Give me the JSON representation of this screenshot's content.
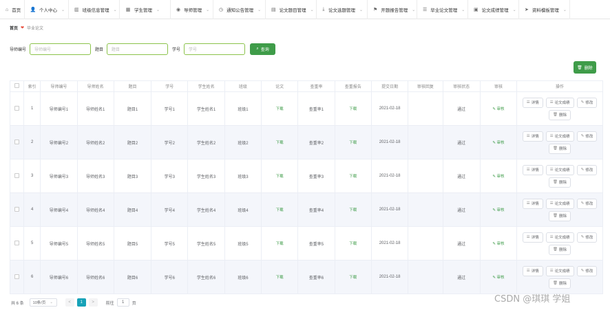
{
  "nav": [
    {
      "label": "首页",
      "icon": "home-icon",
      "glyph": "⌂",
      "chevron": false
    },
    {
      "label": "个人中心",
      "icon": "user-icon",
      "glyph": "👤",
      "chevron": true
    },
    {
      "label": "班级信息管理",
      "icon": "chart-icon",
      "glyph": "▥",
      "chevron": true
    },
    {
      "label": "学生管理",
      "icon": "grid-icon",
      "glyph": "▦",
      "chevron": true
    },
    {
      "label": "导师管理",
      "icon": "eye-icon",
      "glyph": "◉",
      "chevron": true
    },
    {
      "label": "通知公告管理",
      "icon": "clock-icon",
      "glyph": "◷",
      "chevron": true
    },
    {
      "label": "论文题目管理",
      "icon": "doc-icon",
      "glyph": "▤",
      "chevron": true
    },
    {
      "label": "论文选题管理",
      "icon": "download-icon",
      "glyph": "⤓",
      "chevron": true
    },
    {
      "label": "开题报告管理",
      "icon": "flag-icon",
      "glyph": "⚑",
      "chevron": true
    },
    {
      "label": "毕业论文管理",
      "icon": "list-icon",
      "glyph": "☰",
      "chevron": true
    },
    {
      "label": "论文成绩管理",
      "icon": "image-icon",
      "glyph": "▣",
      "chevron": true
    },
    {
      "label": "资料模板管理",
      "icon": "send-icon",
      "glyph": "➤",
      "chevron": true
    }
  ],
  "breadcrumb": {
    "home": "首页",
    "current": "毕业论文"
  },
  "search": {
    "tutor_no_label": "导师编号",
    "tutor_no_placeholder": "导师编号",
    "title_label": "题目",
    "title_placeholder": "题目",
    "student_no_label": "学号",
    "student_no_placeholder": "学号",
    "button": "查询"
  },
  "toolbar": {
    "delete_label": "删除"
  },
  "table": {
    "headers": [
      "",
      "索引",
      "导师编号",
      "导师姓名",
      "题目",
      "学号",
      "学生姓名",
      "班级",
      "论文",
      "查重率",
      "查重报告",
      "提交日期",
      "审核回复",
      "审核状态",
      "审核",
      "操作"
    ],
    "rows": [
      {
        "index": "1",
        "tutor_no": "导师编号1",
        "tutor_name": "导师姓名1",
        "title": "题目1",
        "student_no": "学号1",
        "student_name": "学生姓名1",
        "class": "班级1",
        "paper": "下载",
        "dup_rate": "查重率1",
        "report": "下载",
        "date": "2021-02-18",
        "reply": "",
        "status": "通过",
        "review": "审核"
      },
      {
        "index": "2",
        "tutor_no": "导师编号2",
        "tutor_name": "导师姓名2",
        "title": "题目2",
        "student_no": "学号2",
        "student_name": "学生姓名2",
        "class": "班级2",
        "paper": "下载",
        "dup_rate": "查重率2",
        "report": "下载",
        "date": "2021-02-18",
        "reply": "",
        "status": "通过",
        "review": "审核"
      },
      {
        "index": "3",
        "tutor_no": "导师编号3",
        "tutor_name": "导师姓名3",
        "title": "题目3",
        "student_no": "学号3",
        "student_name": "学生姓名3",
        "class": "班级3",
        "paper": "下载",
        "dup_rate": "查重率3",
        "report": "下载",
        "date": "2021-02-18",
        "reply": "",
        "status": "通过",
        "review": "审核"
      },
      {
        "index": "4",
        "tutor_no": "导师编号4",
        "tutor_name": "导师姓名4",
        "title": "题目4",
        "student_no": "学号4",
        "student_name": "学生姓名4",
        "class": "班级4",
        "paper": "下载",
        "dup_rate": "查重率4",
        "report": "下载",
        "date": "2021-02-18",
        "reply": "",
        "status": "通过",
        "review": "审核"
      },
      {
        "index": "5",
        "tutor_no": "导师编号5",
        "tutor_name": "导师姓名5",
        "title": "题目5",
        "student_no": "学号5",
        "student_name": "学生姓名5",
        "class": "班级5",
        "paper": "下载",
        "dup_rate": "查重率5",
        "report": "下载",
        "date": "2021-02-18",
        "reply": "",
        "status": "通过",
        "review": "审核"
      },
      {
        "index": "6",
        "tutor_no": "导师编号6",
        "tutor_name": "导师姓名6",
        "title": "题目6",
        "student_no": "学号6",
        "student_name": "学生姓名6",
        "class": "班级6",
        "paper": "下载",
        "dup_rate": "查重率6",
        "report": "下载",
        "date": "2021-02-18",
        "reply": "",
        "status": "通过",
        "review": "审核"
      }
    ],
    "actions": {
      "detail": "详情",
      "score": "论文成绩",
      "edit": "修改",
      "delete": "删除"
    }
  },
  "pagination": {
    "total": "共 6 条",
    "page_size": "10条/页",
    "current_page": "1",
    "goto_label": "前往",
    "goto_value": "1",
    "page_suffix": "页",
    "prev": "<",
    "next": ">"
  },
  "watermark": "CSDN @琪琪 学姐",
  "colors": {
    "accent": "#3f9c49",
    "active_page": "#17a2b8",
    "link": "#3f9c49"
  }
}
